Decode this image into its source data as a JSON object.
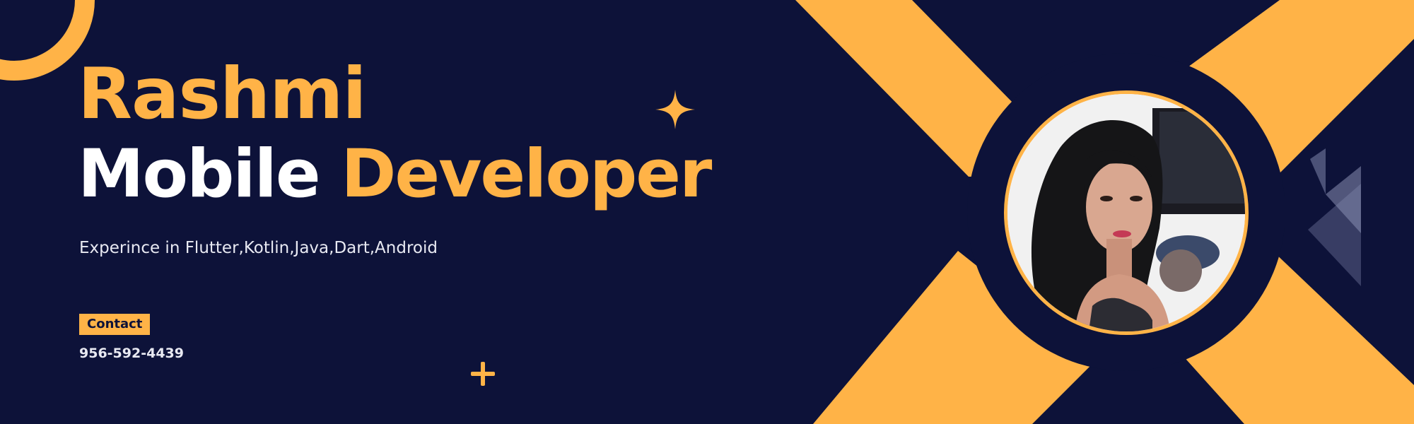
{
  "header": {
    "name": "Rashmi",
    "role_part1": "Mobile",
    "role_part2": "Developer"
  },
  "experience_text": "Experince in Flutter,Kotlin,Java,Dart,Android",
  "contact": {
    "label": "Contact",
    "phone": "956-592-4439"
  },
  "colors": {
    "background": "#0d1239",
    "accent": "#ffb347",
    "text_light": "#e8e9f2"
  },
  "icons": [
    "sparkle-icon",
    "plus-icon",
    "triangle-decoration"
  ],
  "photo": {
    "alt": "Profile photo of Rashmi"
  }
}
